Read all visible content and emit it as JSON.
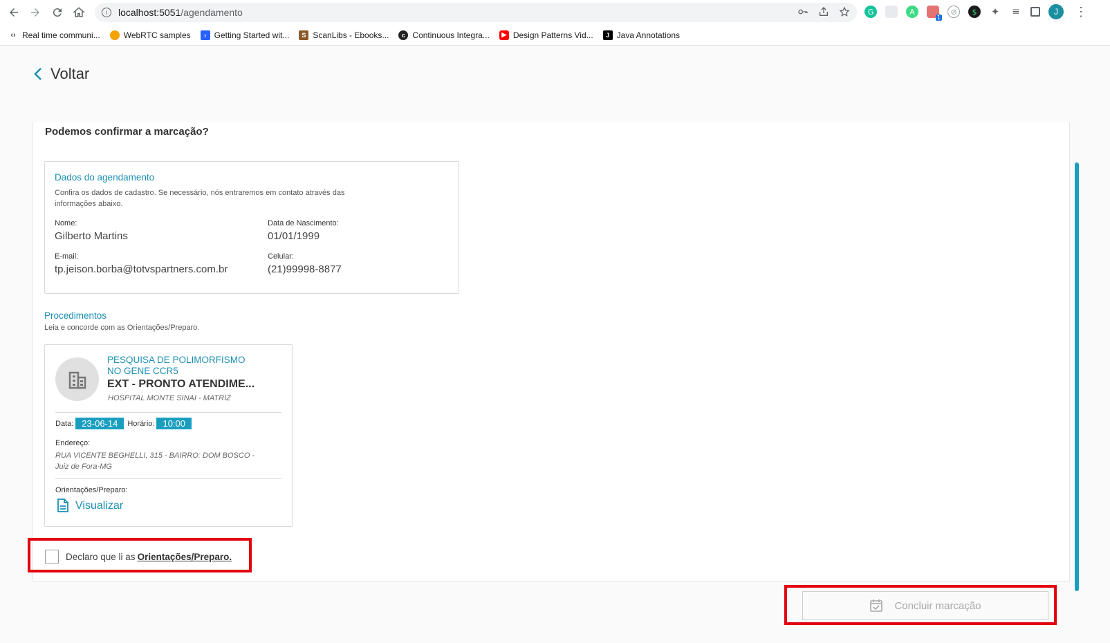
{
  "browser": {
    "url_host": "localhost:5051",
    "url_path": "/agendamento",
    "avatar_letter": "J",
    "ext_badge": "1"
  },
  "bookmarks": [
    {
      "label": "Real time communi...",
      "icon": "code-brackets-icon",
      "color": "#444444"
    },
    {
      "label": "WebRTC samples",
      "icon": "webrtc-icon",
      "color": "#f4a300"
    },
    {
      "label": "Getting Started wit...",
      "icon": "vscode-icon",
      "color": "#2962ff"
    },
    {
      "label": "ScanLibs - Ebooks...",
      "icon": "scanlibs-icon",
      "color": "#8b5a2b"
    },
    {
      "label": "Continuous Integra...",
      "icon": "circleci-icon",
      "color": "#222222"
    },
    {
      "label": "Design Patterns Vid...",
      "icon": "youtube-icon",
      "color": "#ff0000"
    },
    {
      "label": "Java Annotations",
      "icon": "j-icon",
      "color": "#000000"
    }
  ],
  "page": {
    "back_label": "Voltar",
    "question": "Podemos confirmar a marcação?",
    "dados": {
      "title": "Dados do agendamento",
      "desc_line1": "Confira os dados de cadastro. Se necessário, nós entraremos em contato através das",
      "desc_line2": "informações abaixo.",
      "nome_label": "Nome:",
      "nome_value": "Gilberto Martins",
      "nasc_label": "Data de Nascimento:",
      "nasc_value": "01/01/1999",
      "email_label": "E-mail:",
      "email_value": "tp.jeison.borba@totvspartners.com.br",
      "cel_label": "Celular:",
      "cel_value": "(21)99998-8877"
    },
    "procedimentos": {
      "title": "Procedimentos",
      "desc": "Leia e concorde com as Orientações/Preparo.",
      "item": {
        "name_line1": "PESQUISA DE POLIMORFISMO",
        "name_line2": "NO GENE CCR5",
        "unit": "EXT - PRONTO ATENDIME...",
        "hospital": "HOSPITAL MONTE SINAI - MATRIZ",
        "data_label": "Data:",
        "data_value": "23-06-14",
        "hora_label": "Horário:",
        "hora_value": "10:00",
        "endereco_label": "Endereço:",
        "endereco_line1": "RUA VICENTE BEGHELLI, 315 - BAIRRO: DOM BOSCO -",
        "endereco_line2": "Juiz de Fora-MG",
        "orientacoes_label": "Orientações/Preparo:",
        "visualizar_label": "Visualizar"
      }
    },
    "declaracao": {
      "text": "Declaro que li as",
      "link": "Orientações/Preparo."
    },
    "concluir_label": "Concluir marcação"
  },
  "colors": {
    "accent": "#1a8fb3",
    "tag_bg": "#1a9ec0",
    "highlight": "#e3000f"
  }
}
